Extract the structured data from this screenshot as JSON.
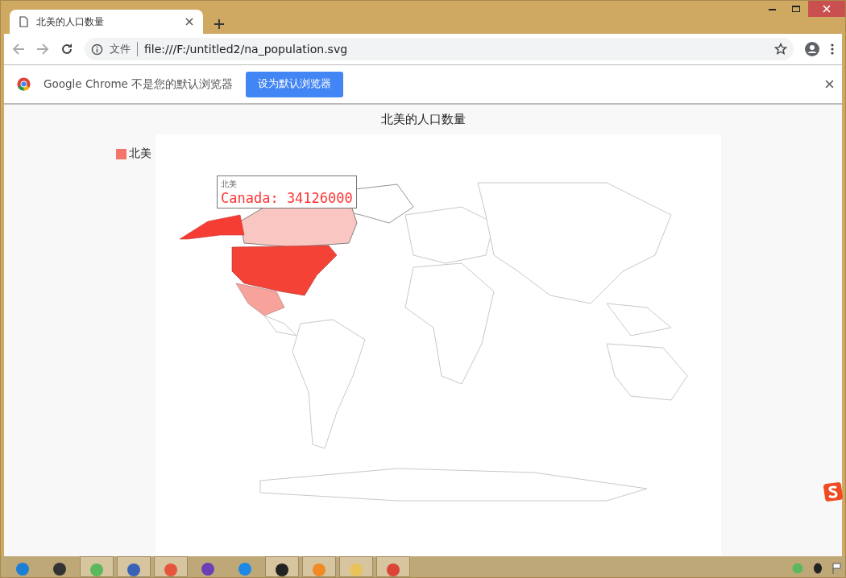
{
  "tab": {
    "title": "北美的人口数量",
    "selected": true
  },
  "address_bar": {
    "scheme_label": "文件",
    "url": "file:///F:/untitled2/na_population.svg"
  },
  "infobar": {
    "message": "Google Chrome 不是您的默认浏览器",
    "button": "设为默认浏览器"
  },
  "chart": {
    "title": "北美的人口数量",
    "legend": [
      {
        "label": "北美",
        "color": "#f4756b"
      }
    ],
    "tooltip": {
      "series": "北美",
      "text": "Canada: 34126000"
    }
  }
}
